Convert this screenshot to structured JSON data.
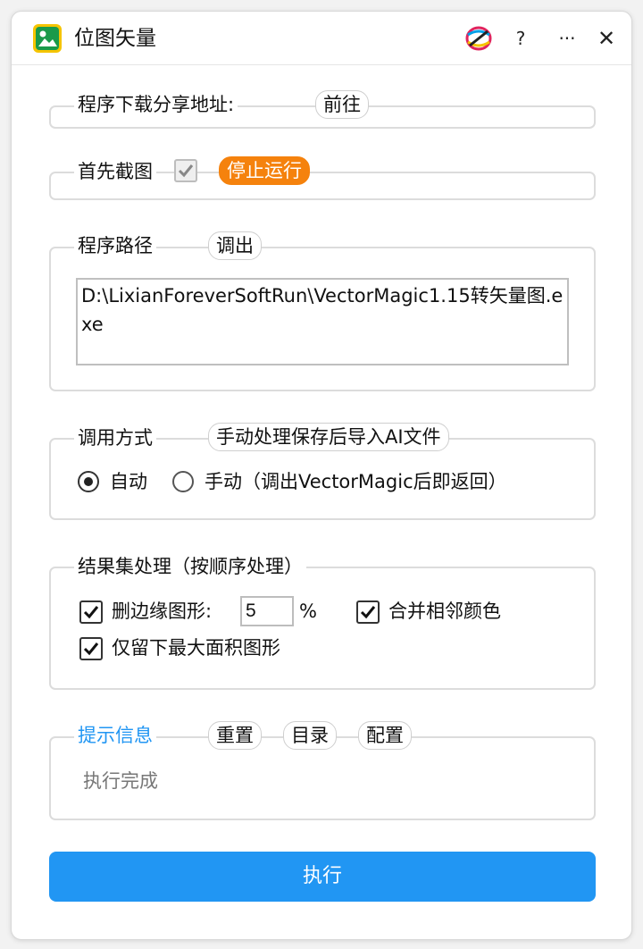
{
  "window": {
    "title": "位图矢量",
    "help_label": "?",
    "more_label": "···",
    "close_label": "✕",
    "accent_color": "#2196f3"
  },
  "download": {
    "title": "程序下载分享地址:",
    "go_button": "前往"
  },
  "capture": {
    "label": "首先截图",
    "checked": true,
    "stop_button": "停止运行",
    "stop_color": "#f5820d"
  },
  "program_path": {
    "title": "程序路径",
    "open_button": "调出",
    "value": "D:\\LixianForeverSoftRun\\VectorMagic1.15转矢量图.exe"
  },
  "invoke_mode": {
    "title": "调用方式",
    "manual_import_button": "手动处理保存后导入AI文件",
    "options": [
      "自动",
      "手动（调出VectorMagic后即返回）"
    ],
    "selected": "自动"
  },
  "result_processing": {
    "title": "结果集处理（按顺序处理）",
    "remove_edge_label": "删边缘图形:",
    "remove_edge_value": "5",
    "percent": "%",
    "merge_colors_label": "合并相邻颜色",
    "keep_largest_label": "仅留下最大面积图形"
  },
  "info": {
    "title": "提示信息",
    "title_color": "#2196f3",
    "reset_button": "重置",
    "dir_button": "目录",
    "config_button": "配置",
    "status": "执行完成"
  },
  "execute_button": "执行"
}
